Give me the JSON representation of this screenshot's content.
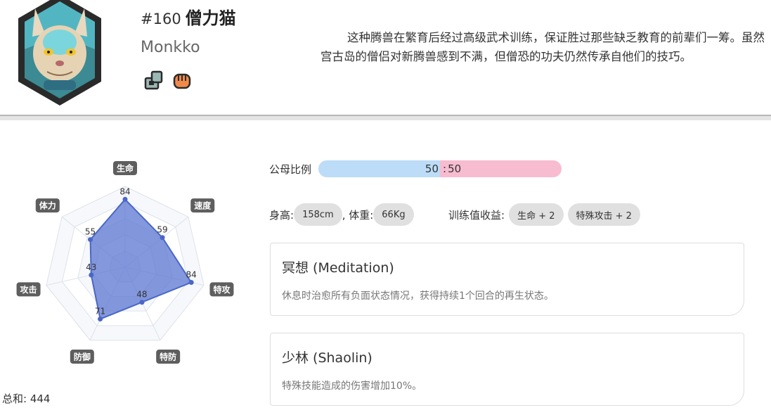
{
  "pokemon": {
    "number": "#160",
    "name_cn": "僧力猫",
    "name_en": "Monkko",
    "types": [
      "fighting-type-icon",
      "fist-type-icon"
    ],
    "description": "这种腾兽在繁育后经过高级武术训练，保证胜过那些缺乏教育的前辈们一筹。虽然宫古岛的僧侣对新腾兽感到不满，但僧恐的功夫仍然传承自他们的技巧。"
  },
  "stats": {
    "labels": [
      "生命",
      "速度",
      "特攻",
      "特防",
      "防御",
      "攻击",
      "体力"
    ],
    "values": [
      84,
      59,
      84,
      48,
      71,
      43,
      55
    ],
    "max": 100,
    "total_label": "总和: 444"
  },
  "gender": {
    "label": "公母比例",
    "male": "50",
    "separator": ":",
    "female": "50"
  },
  "physical": {
    "height_label": "身高:",
    "height": "158cm",
    "weight_label": ", 体重:",
    "weight": "66Kg"
  },
  "ev": {
    "label": "训练值收益:",
    "items": [
      "生命 + 2",
      "特殊攻击 + 2"
    ]
  },
  "abilities": [
    {
      "name": "冥想 (Meditation)",
      "desc": "休息时治愈所有负面状态情况，获得持续1个回合的再生状态。"
    },
    {
      "name": "少林 (Shaolin)",
      "desc": "特殊技能造成的伤害增加10%。"
    }
  ],
  "colors": {
    "radar_fill": "#5b76d2",
    "radar_stroke": "#4a67c7",
    "gender_male": "#bcdcf7",
    "gender_female": "#f7bcd0"
  }
}
